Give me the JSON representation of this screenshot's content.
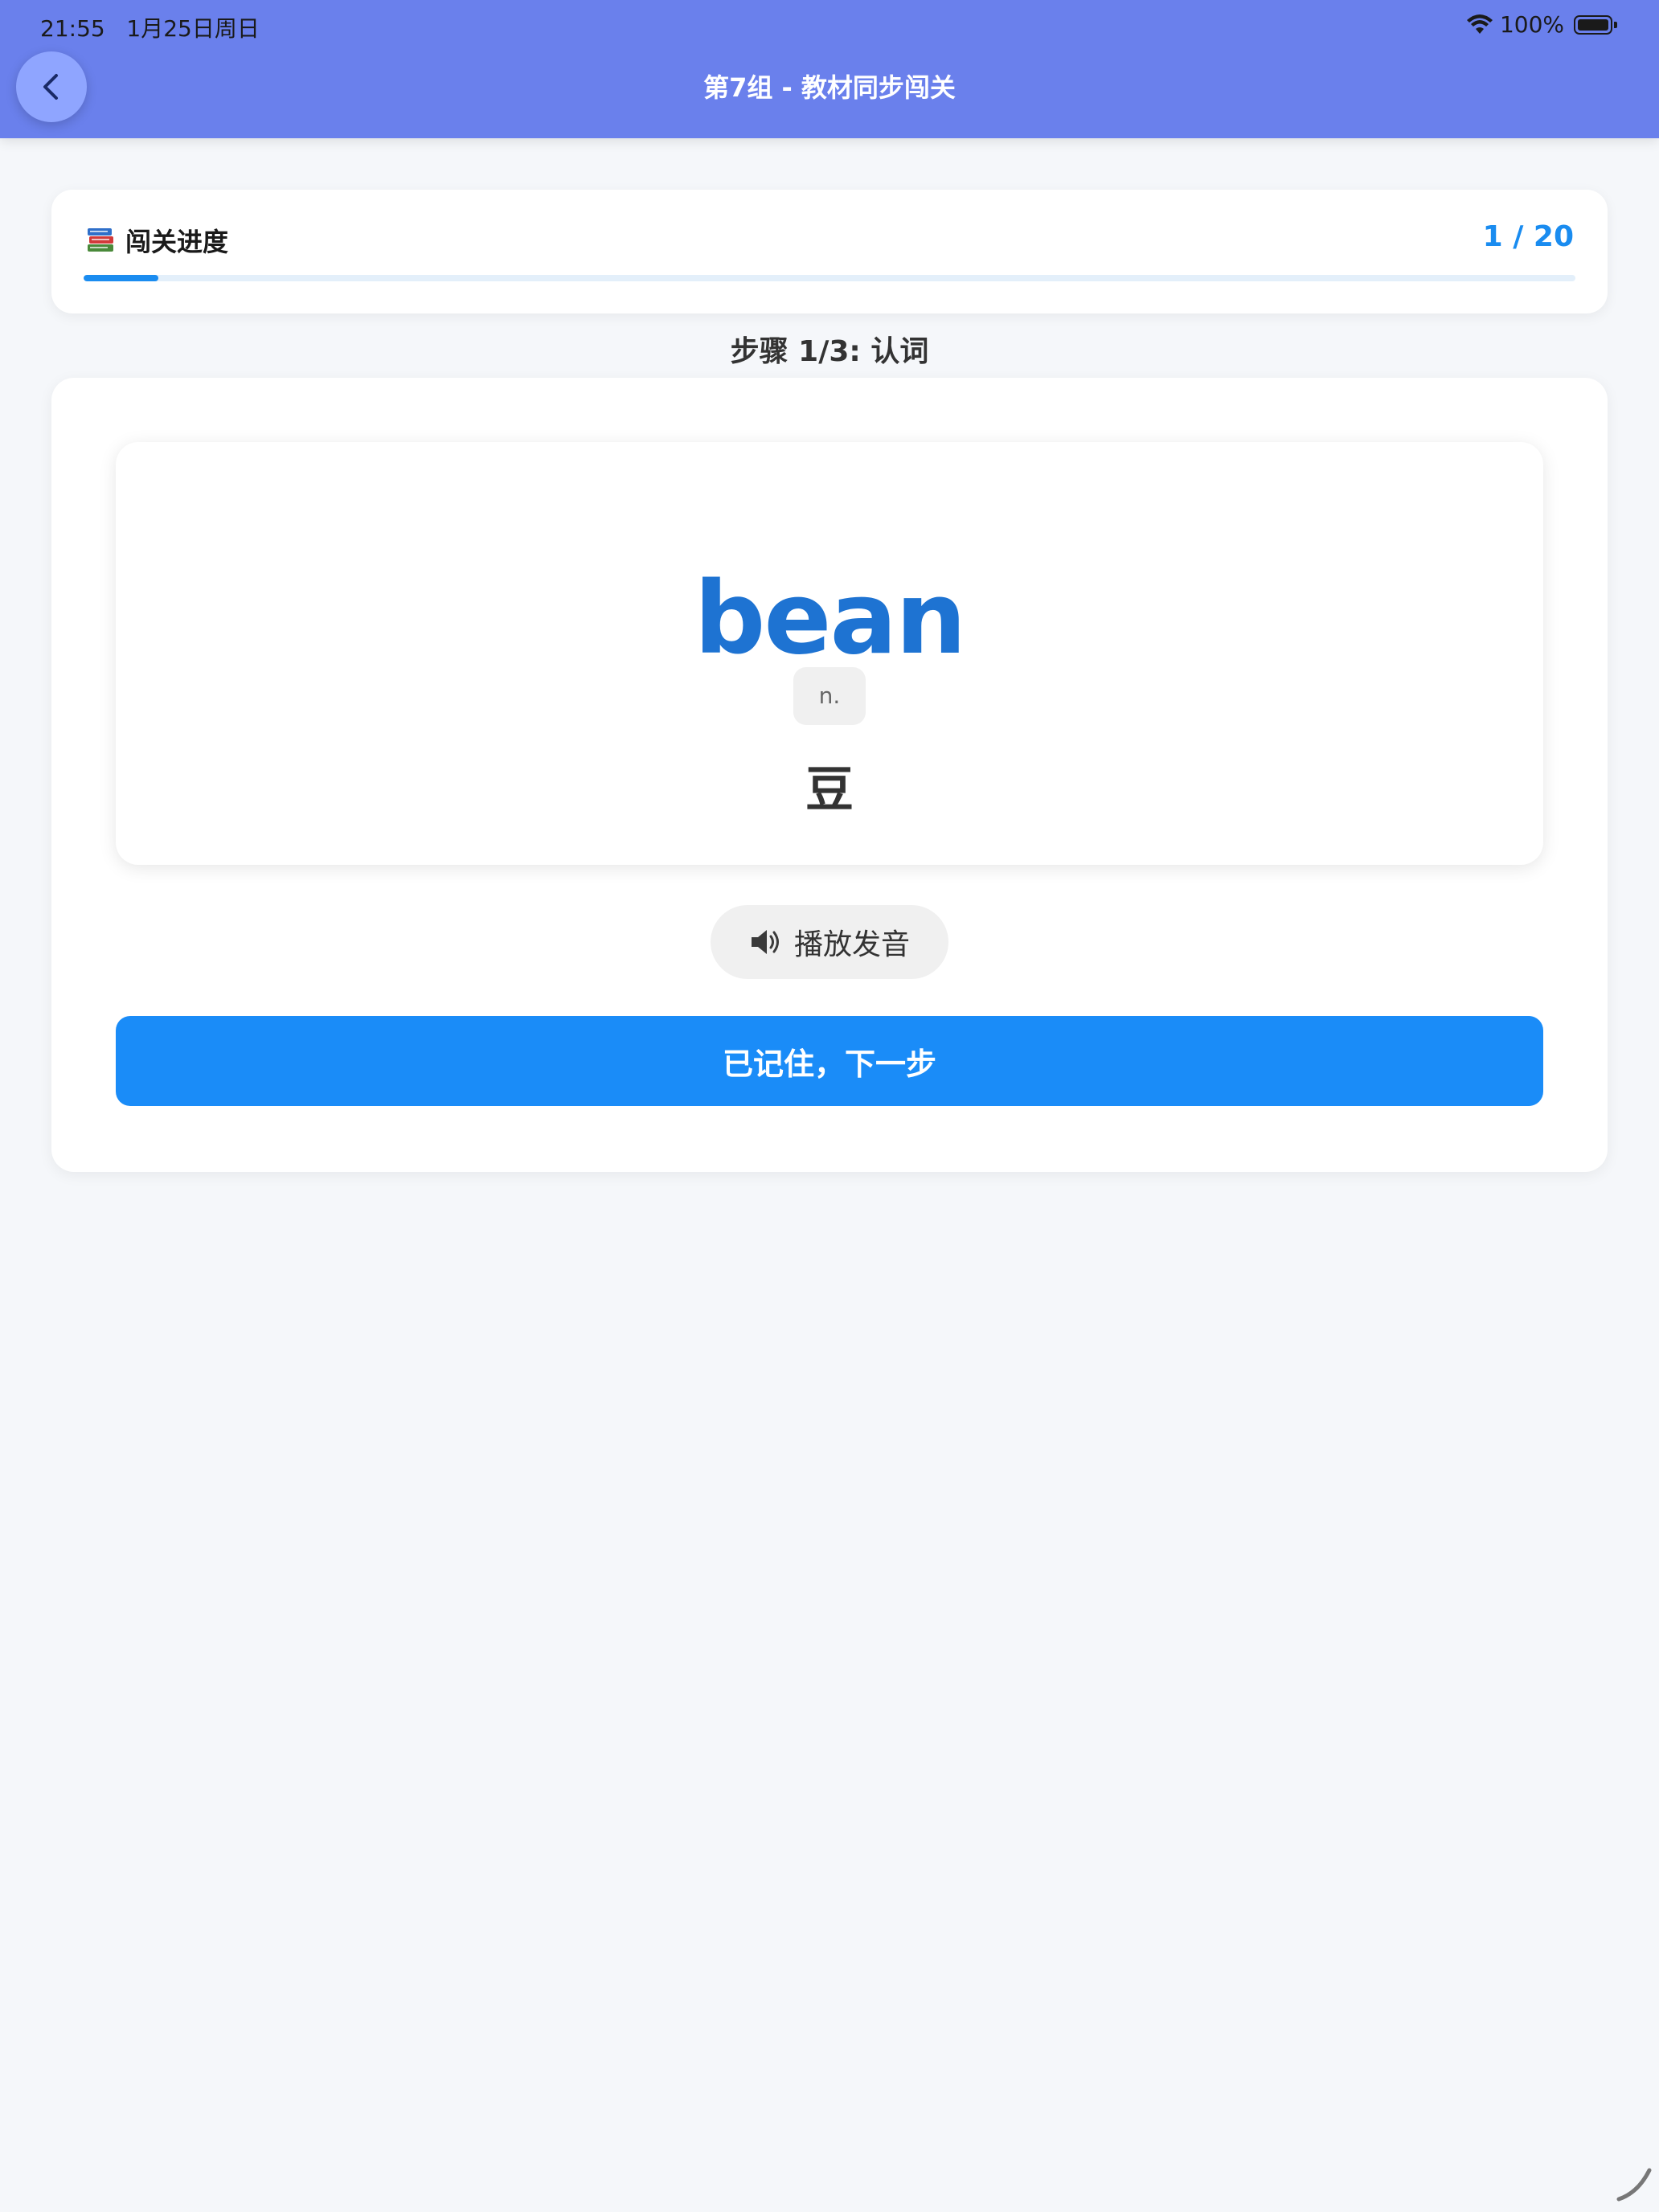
{
  "status_bar": {
    "time": "21:55",
    "date": "1月25日周日",
    "battery": "100%"
  },
  "header": {
    "title": "第7组 - 教材同步闯关",
    "color": "#6a80ec"
  },
  "progress": {
    "label": "闯关进度",
    "current": 1,
    "total": 20,
    "count_text": "1 / 20",
    "fraction": 0.05,
    "accent": "#1a8cf0"
  },
  "step": {
    "title": "步骤 1/3: 认词"
  },
  "word_card": {
    "word": "bean",
    "part_of_speech": "n.",
    "meaning": "豆"
  },
  "actions": {
    "play_label": "播放发音",
    "next_label": "已记住，下一步",
    "next_color": "#1a8cf8"
  },
  "icons": {
    "back": "chevron-left-icon",
    "books": "books-icon",
    "speaker": "speaker-icon",
    "wifi": "wifi-icon",
    "battery": "battery-icon"
  }
}
